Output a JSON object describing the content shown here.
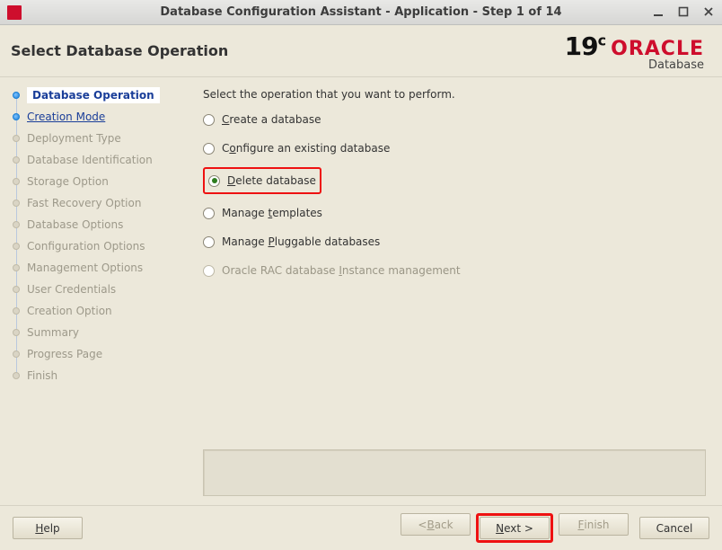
{
  "window": {
    "title": "Database Configuration Assistant - Application - Step 1 of 14"
  },
  "header": {
    "title": "Select Database Operation",
    "version": "19",
    "version_suffix": "c",
    "brand_name": "ORACLE",
    "brand_sub": "Database"
  },
  "sidebar": {
    "steps": [
      {
        "label": "Database Operation",
        "state": "current"
      },
      {
        "label": "Creation Mode",
        "state": "active"
      },
      {
        "label": "Deployment Type",
        "state": "upcoming"
      },
      {
        "label": "Database Identification",
        "state": "upcoming"
      },
      {
        "label": "Storage Option",
        "state": "upcoming"
      },
      {
        "label": "Fast Recovery Option",
        "state": "upcoming"
      },
      {
        "label": "Database Options",
        "state": "upcoming"
      },
      {
        "label": "Configuration Options",
        "state": "upcoming"
      },
      {
        "label": "Management Options",
        "state": "upcoming"
      },
      {
        "label": "User Credentials",
        "state": "upcoming"
      },
      {
        "label": "Creation Option",
        "state": "upcoming"
      },
      {
        "label": "Summary",
        "state": "upcoming"
      },
      {
        "label": "Progress Page",
        "state": "upcoming"
      },
      {
        "label": "Finish",
        "state": "upcoming"
      }
    ]
  },
  "content": {
    "instruction": "Select the operation that you want to perform.",
    "options": [
      {
        "pre": "",
        "mn": "C",
        "post": "reate a database",
        "selected": false,
        "disabled": false,
        "highlighted": false
      },
      {
        "pre": "C",
        "mn": "o",
        "post": "nfigure an existing database",
        "selected": false,
        "disabled": false,
        "highlighted": false
      },
      {
        "pre": "",
        "mn": "D",
        "post": "elete database",
        "selected": true,
        "disabled": false,
        "highlighted": true
      },
      {
        "pre": "Manage ",
        "mn": "t",
        "post": "emplates",
        "selected": false,
        "disabled": false,
        "highlighted": false
      },
      {
        "pre": "Manage ",
        "mn": "P",
        "post": "luggable databases",
        "selected": false,
        "disabled": false,
        "highlighted": false
      },
      {
        "pre": "Oracle RAC database ",
        "mn": "I",
        "post": "nstance management",
        "selected": false,
        "disabled": true,
        "highlighted": false
      }
    ]
  },
  "footer": {
    "help": {
      "pre": "",
      "mn": "H",
      "post": "elp"
    },
    "back": {
      "pre": "< ",
      "mn": "B",
      "post": "ack",
      "disabled": true
    },
    "next": {
      "pre": "",
      "mn": "N",
      "post": "ext >",
      "disabled": false,
      "highlighted": true
    },
    "finish": {
      "pre": "",
      "mn": "F",
      "post": "inish",
      "disabled": true
    },
    "cancel": {
      "pre": "Cancel",
      "mn": "",
      "post": "",
      "disabled": false
    }
  }
}
